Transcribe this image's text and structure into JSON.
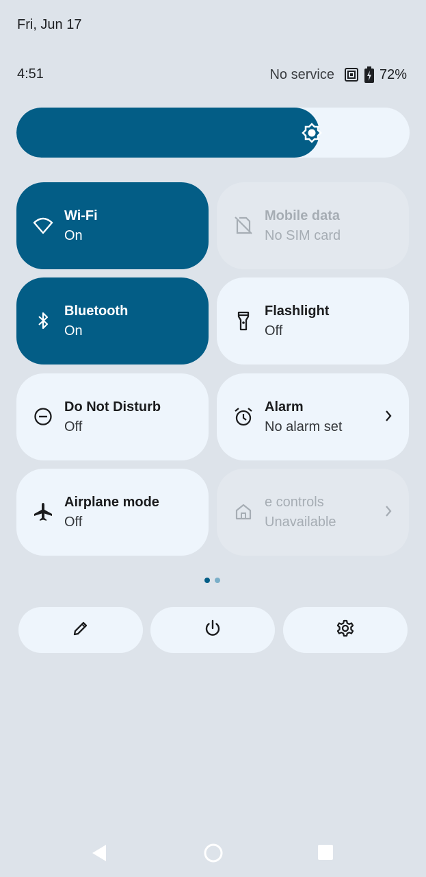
{
  "header": {
    "date": "Fri, Jun 17",
    "time": "4:51",
    "network": "No service",
    "battery": "72%"
  },
  "brightness": {
    "level": 0.77
  },
  "tiles": [
    {
      "label": "Wi-Fi",
      "sub": "On",
      "icon": "wifi-icon",
      "state": "on"
    },
    {
      "label": "Mobile data",
      "sub": "No SIM card",
      "icon": "no-sim-icon",
      "state": "unavailable"
    },
    {
      "label": "Bluetooth",
      "sub": "On",
      "icon": "bluetooth-icon",
      "state": "on"
    },
    {
      "label": "Flashlight",
      "sub": "Off",
      "icon": "flashlight-icon",
      "state": "off"
    },
    {
      "label": "Do Not Disturb",
      "sub": "Off",
      "icon": "do-not-disturb-icon",
      "state": "off"
    },
    {
      "label": "Alarm",
      "sub": "No alarm set",
      "icon": "alarm-icon",
      "state": "off"
    },
    {
      "label": "Airplane mode",
      "sub": "Off",
      "icon": "airplane-icon",
      "state": "off"
    },
    {
      "label": "e controls",
      "sub": "Unavailable",
      "icon": "home-icon",
      "state": "unavailable"
    }
  ],
  "pager": {
    "pages": 2,
    "current": 1
  },
  "actions": [
    "edit-icon",
    "power-icon",
    "settings-icon"
  ],
  "colors": {
    "background": "#dde3ea",
    "accent": "#035d86",
    "tile_off": "#eef5fc",
    "tile_unavailable": "#e3e8ee"
  }
}
